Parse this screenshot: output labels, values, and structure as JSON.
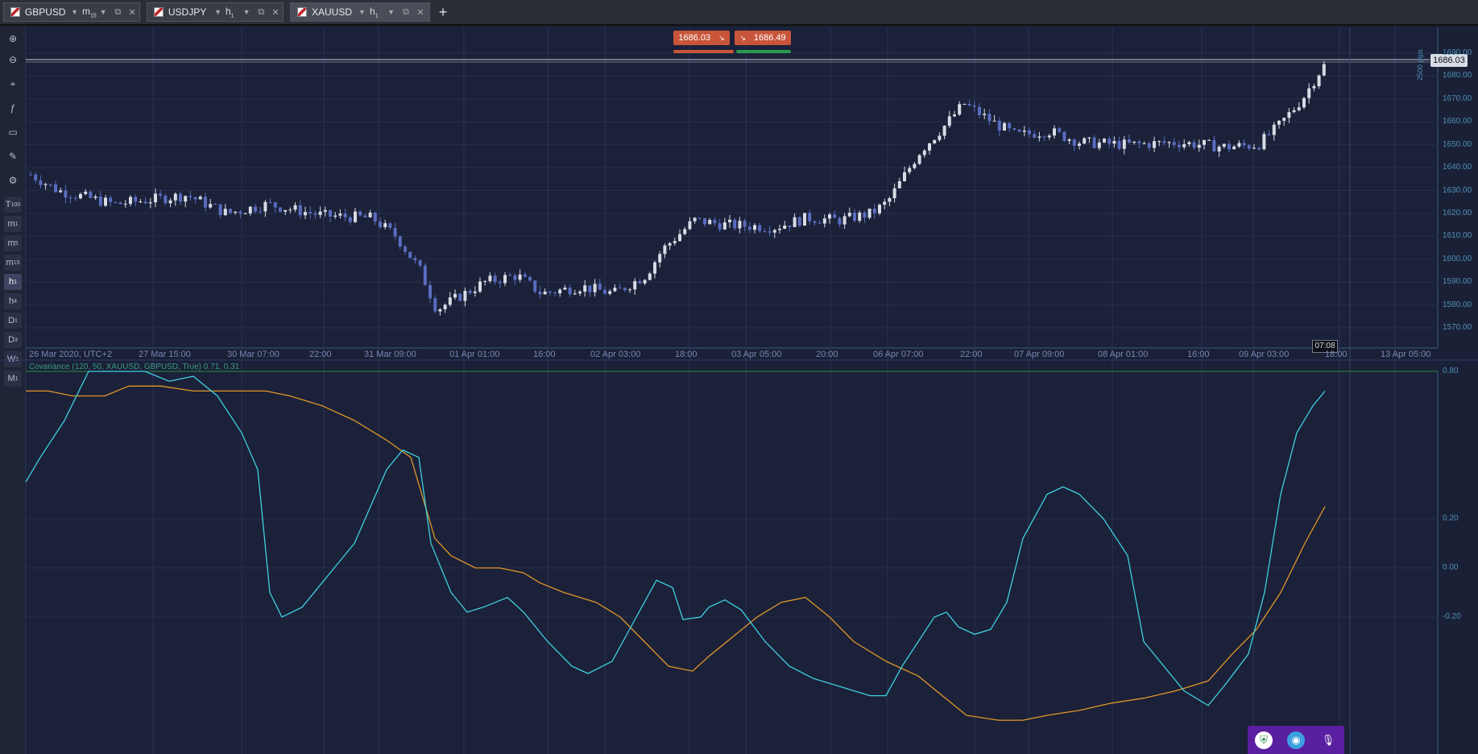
{
  "tabs": [
    {
      "symbol": "GBPUSD",
      "timeframe": "m15",
      "active": false
    },
    {
      "symbol": "USDJPY",
      "timeframe": "h1",
      "active": false
    },
    {
      "symbol": "XAUUSD",
      "timeframe": "h1",
      "active": true
    }
  ],
  "add_tab_label": "+",
  "toolbar": {
    "tools": [
      "zoom-in-icon",
      "zoom-out-icon",
      "crosshair-icon",
      "indicator-icon",
      "chart-type-icon",
      "drawing-icon",
      "settings-icon"
    ],
    "timeframes": [
      {
        "main": "T",
        "sub": "100",
        "selected": false
      },
      {
        "main": "m",
        "sub": "1",
        "selected": false
      },
      {
        "main": "m",
        "sub": "5",
        "selected": false
      },
      {
        "main": "m",
        "sub": "15",
        "selected": false
      },
      {
        "main": "h",
        "sub": "1",
        "selected": true
      },
      {
        "main": "h",
        "sub": "4",
        "selected": false
      },
      {
        "main": "D",
        "sub": "1",
        "selected": false
      },
      {
        "main": "D",
        "sub": "3",
        "selected": false
      },
      {
        "main": "W",
        "sub": "1",
        "selected": false
      },
      {
        "main": "M",
        "sub": "1",
        "selected": false
      }
    ]
  },
  "trade": {
    "sell_price": "1686.03",
    "buy_price": "1686.49",
    "sell_color": "#c8553a",
    "buy_color": "#c8553a"
  },
  "chart": {
    "last_price_label": "1686.03",
    "pips_label": "2500 pips",
    "current_time_label": "07:08",
    "y_ticks": [
      "1690.00",
      "1680.00",
      "1670.00",
      "1660.00",
      "1650.00",
      "1640.00",
      "1630.00",
      "1620.00",
      "1610.00",
      "1600.00",
      "1590.00",
      "1580.00",
      "1570.00"
    ],
    "x_ticks": [
      "26 Mar 2020, UTC+2",
      "27 Mar 15:00",
      "30 Mar 07:00",
      "22:00",
      "31 Mar 09:00",
      "01 Apr 01:00",
      "16:00",
      "02 Apr 03:00",
      "18:00",
      "03 Apr 05:00",
      "20:00",
      "06 Apr 07:00",
      "22:00",
      "07 Apr 09:00",
      "08 Apr 01:00",
      "16:00",
      "09 Apr 03:00",
      "18:00",
      "13 Apr 05:00"
    ],
    "up_color": "#d8dce6",
    "down_color": "#5a6cc0"
  },
  "indicator": {
    "label": "Covariance (120, 50, XAUUSD, GBPUSD, True) 0.71, 0.31",
    "y_ticks": [
      "0.80",
      "0.20",
      "0.00",
      "-0.20"
    ],
    "line1_color": "#3fd0e0",
    "line2_color": "#e0962a"
  },
  "tray_icons": [
    "shield-icon",
    "browser-icon",
    "microphone-icon"
  ]
}
